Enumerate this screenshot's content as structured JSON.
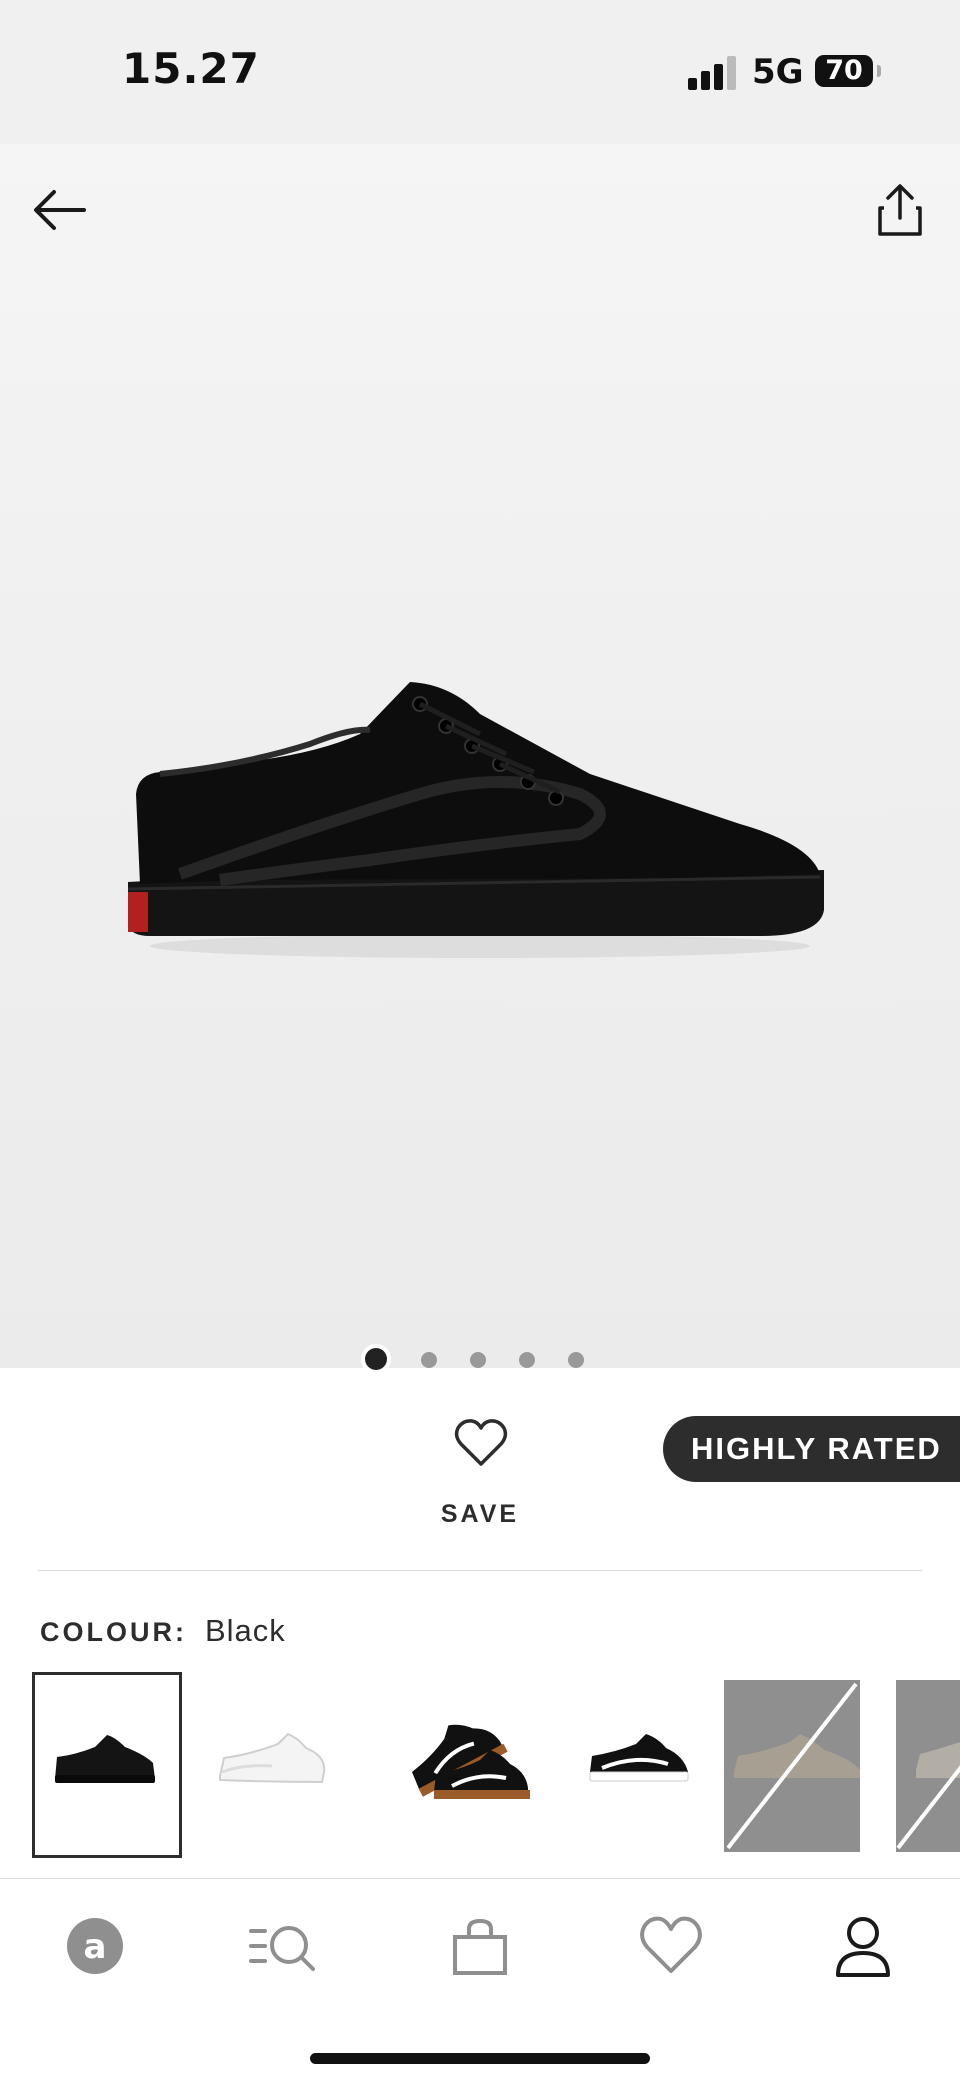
{
  "status_bar": {
    "time": "15.27",
    "network": "5G",
    "battery": "70"
  },
  "product_gallery": {
    "image_icon": "black-low-top-skate-shoe",
    "image_count": 5,
    "active_index": 1,
    "badge": "HIGHLY RATED"
  },
  "actions": {
    "save_label": "SAVE"
  },
  "colour": {
    "label": "COLOUR:",
    "value": "Black",
    "swatches": [
      {
        "icon": "all-black-shoe",
        "selected": true,
        "available": true
      },
      {
        "icon": "all-white-shoe",
        "selected": false,
        "available": true
      },
      {
        "icon": "black-gum-sole-shoe-pair",
        "selected": false,
        "available": true
      },
      {
        "icon": "black-white-shoe",
        "selected": false,
        "available": true
      },
      {
        "icon": "grey-shoe",
        "selected": false,
        "available": false
      },
      {
        "icon": "grey-shoe",
        "selected": false,
        "available": false
      }
    ]
  },
  "tab_bar": {
    "tabs": [
      "home-icon",
      "search-icon",
      "bag-icon",
      "saved-heart-icon",
      "account-icon"
    ]
  },
  "colors": {
    "text": "#2d2d2d",
    "badge_bg": "#2d2d2d",
    "hero_bg": "#f0f0f0"
  }
}
